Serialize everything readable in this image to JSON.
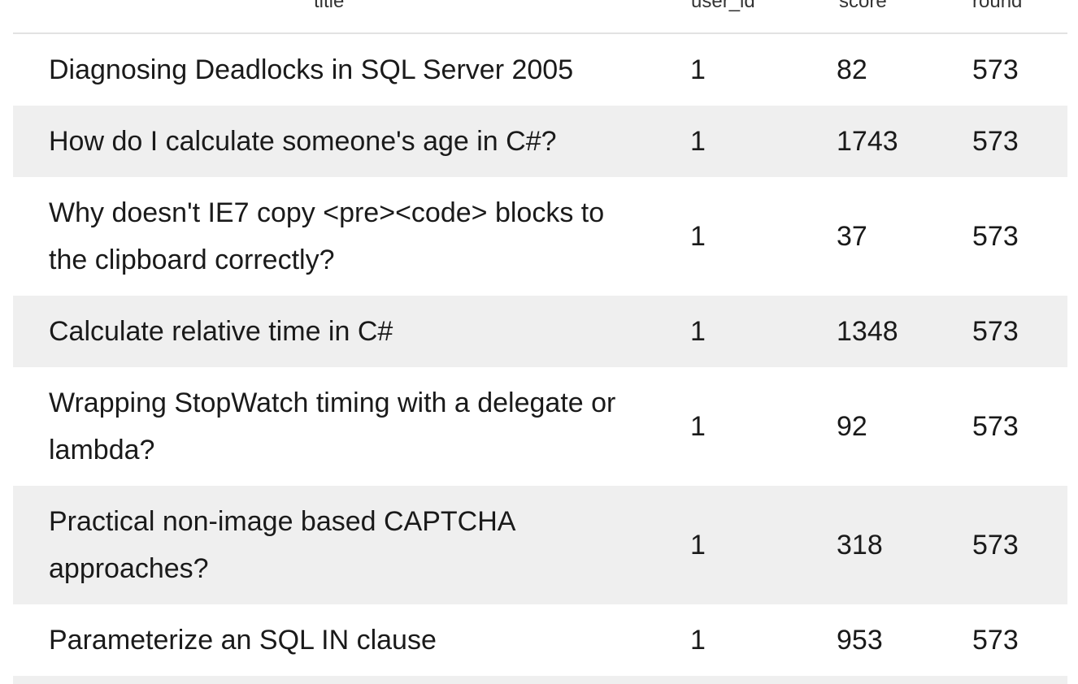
{
  "table": {
    "columns": [
      "title",
      "user_id",
      "score",
      "round"
    ],
    "rows": [
      {
        "title": "Diagnosing Deadlocks in SQL Server 2005",
        "user_id": "1",
        "score": "82",
        "round": "573"
      },
      {
        "title": "How do I calculate someone's age in C#?",
        "user_id": "1",
        "score": "1743",
        "round": "573"
      },
      {
        "title": "Why doesn't IE7 copy <pre><code> blocks to the clipboard correctly?",
        "user_id": "1",
        "score": "37",
        "round": "573"
      },
      {
        "title": "Calculate relative time in C#",
        "user_id": "1",
        "score": "1348",
        "round": "573"
      },
      {
        "title": "Wrapping StopWatch timing with a delegate or lambda?",
        "user_id": "1",
        "score": "92",
        "round": "573"
      },
      {
        "title": "Practical non-image based CAPTCHA approaches?",
        "user_id": "1",
        "score": "318",
        "round": "573"
      },
      {
        "title": "Parameterize an SQL IN clause",
        "user_id": "1",
        "score": "953",
        "round": "573"
      }
    ]
  }
}
